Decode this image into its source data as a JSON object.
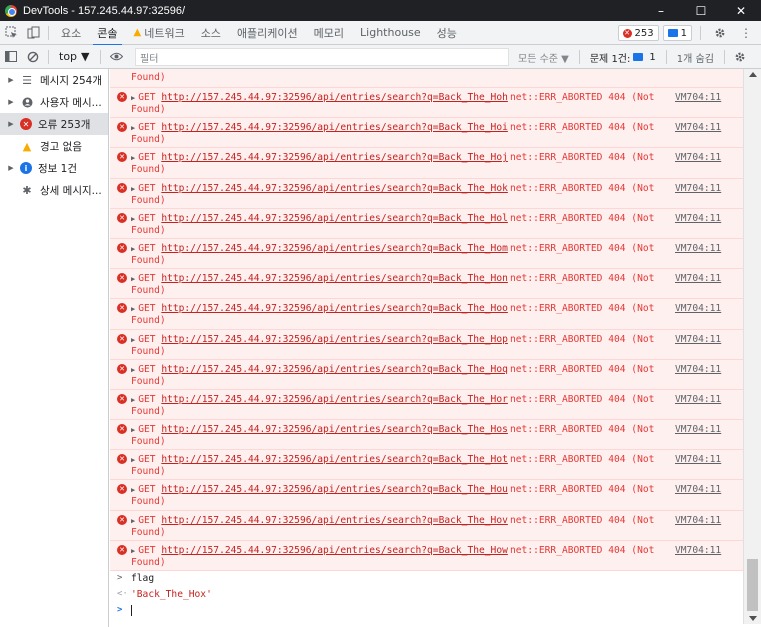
{
  "window": {
    "title": "DevTools - 157.245.44.97:32596/",
    "minimize": "–",
    "maximize": "☐",
    "close": "✕"
  },
  "tabs": [
    {
      "label": "요소"
    },
    {
      "label": "콘솔"
    },
    {
      "label": "네트워크"
    },
    {
      "label": "소스"
    },
    {
      "label": "애플리케이션"
    },
    {
      "label": "메모리"
    },
    {
      "label": "Lighthouse"
    },
    {
      "label": "성능"
    }
  ],
  "badges": {
    "errors": "253",
    "messages": "1"
  },
  "toolbar": {
    "context": "top",
    "filter_placeholder": "필터",
    "levels": "모든 수준 ▼",
    "issues_label": "문제 1건:",
    "issues_count": "1",
    "hidden": "1개 숨김"
  },
  "sidebar": {
    "items": [
      {
        "label": "메시지 254개",
        "icon": "list-icon"
      },
      {
        "label": "사용자 메시...",
        "icon": "user-icon"
      },
      {
        "label": "오류 253개",
        "icon": "error-icon"
      },
      {
        "label": "경고 없음",
        "icon": "warning-icon"
      },
      {
        "label": "정보 1건",
        "icon": "info-icon"
      },
      {
        "label": "상세 메시지...",
        "icon": "bug-icon"
      }
    ]
  },
  "log": {
    "first_row_tail": "Found)",
    "method": "GET",
    "url_prefix": "http://157.245.44.97:32596/api/entries/search?q=Back_The_Ho",
    "error_text": "net::ERR_ABORTED 404 (Not",
    "error_tail": "Found)",
    "source": "VM704:11",
    "suffixes": [
      "h",
      "i",
      "j",
      "k",
      "l",
      "m",
      "n",
      "o",
      "p",
      "q",
      "r",
      "s",
      "t",
      "u",
      "v",
      "w"
    ]
  },
  "repl": {
    "input": "flag",
    "result": "'Back_The_Hox'",
    "prompt": ">",
    "result_prefix": "<·",
    "input_prefix": ">"
  },
  "colors": {
    "error_red": "#d93025",
    "error_bg": "#fff0f0",
    "accent_blue": "#1a73e8",
    "warning_yellow": "#f9ab00",
    "titlebar": "#202124"
  }
}
